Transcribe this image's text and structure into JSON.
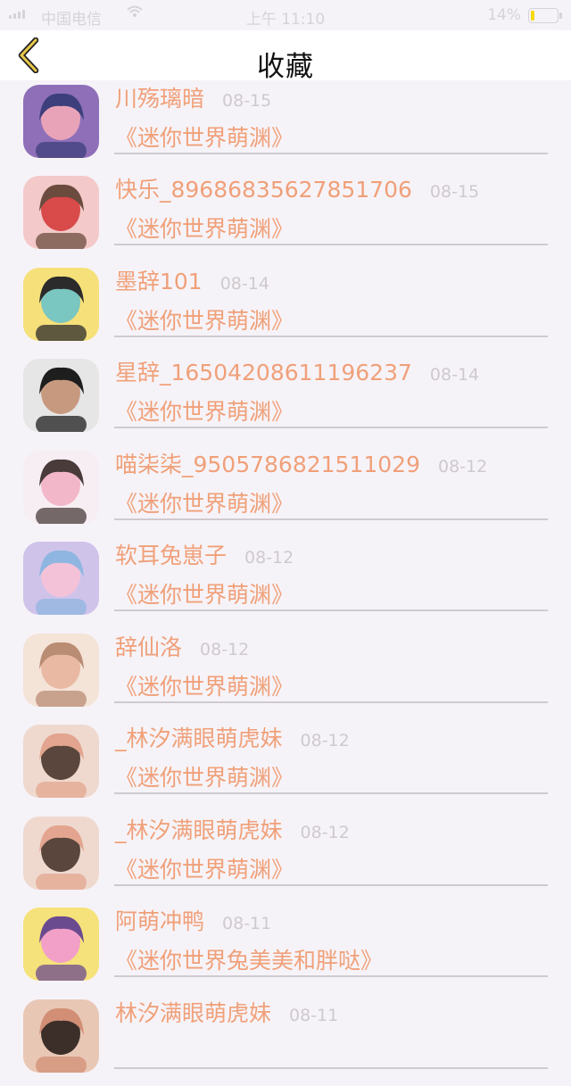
{
  "status_bar": {
    "carrier": "中国电信",
    "time": "上午 11:10",
    "battery": "14%",
    "battery_level": 0.14,
    "signal_icon": "signal-icon",
    "wifi_icon": "wifi-icon",
    "battery_icon": "battery-icon"
  },
  "nav": {
    "title": "收藏",
    "back_icon": "chevron-left-icon",
    "accent_color": "#e8c84a"
  },
  "colors": {
    "name": "#f0a079",
    "date": "#cfc9cd",
    "divider": "#cfcacf",
    "background": "#f6f3f8"
  },
  "favorites": [
    {
      "author": "川殇璃暗",
      "date": "08-15",
      "title": "《迷你世界萌渊》",
      "avatar_colors": [
        "#8e6fb8",
        "#e9a3b8",
        "#3d3f7c"
      ]
    },
    {
      "author": "快乐_89686835627851706",
      "date": "08-15",
      "title": "《迷你世界萌渊》",
      "avatar_colors": [
        "#f4c9c9",
        "#d94a4a",
        "#6b4b3e"
      ]
    },
    {
      "author": "墨辞101",
      "date": "08-14",
      "title": "《迷你世界萌渊》",
      "avatar_colors": [
        "#f6e07a",
        "#7ac6c1",
        "#2b2b2b"
      ]
    },
    {
      "author": "星辞_1650420861119623​7",
      "date": "08-14",
      "title": "《迷你世界萌渊》",
      "avatar_colors": [
        "#e6e6e6",
        "#c79a7f",
        "#1e1e1e"
      ]
    },
    {
      "author": "喵柒柒_9505786821511029",
      "date": "08-12",
      "title": "《迷你世界萌渊》",
      "avatar_colors": [
        "#f7eef3",
        "#f2b7c8",
        "#4a3b3b"
      ]
    },
    {
      "author": "软耳兔崽子",
      "date": "08-12",
      "title": "《迷你世界萌渊》",
      "avatar_colors": [
        "#cfc3ea",
        "#f4c2d8",
        "#8fb6e0"
      ]
    },
    {
      "author": "辞仙洛",
      "date": "08-12",
      "title": "《迷你世界萌渊》",
      "avatar_colors": [
        "#f4e3d7",
        "#e9b9a3",
        "#b98c74"
      ]
    },
    {
      "author": "_林汐满眼萌虎妹",
      "date": "08-12",
      "title": "《迷你世界萌渊》",
      "avatar_colors": [
        "#efd9cf",
        "#5a463c",
        "#e3a58f"
      ]
    },
    {
      "author": "_林汐满眼萌虎妹",
      "date": "08-12",
      "title": "《迷你世界萌渊》",
      "avatar_colors": [
        "#efd9cf",
        "#5a463c",
        "#e3a58f"
      ]
    },
    {
      "author": "阿萌冲鸭",
      "date": "08-11",
      "title": "《迷你世界兔美美和胖哒》",
      "avatar_colors": [
        "#f6e27a",
        "#f2a0c8",
        "#6b4b8f"
      ]
    },
    {
      "author": "林汐满眼萌虎妹",
      "date": "08-11",
      "title": "",
      "avatar_colors": [
        "#e9c7b5",
        "#3c2f2a",
        "#d28f76"
      ]
    }
  ]
}
